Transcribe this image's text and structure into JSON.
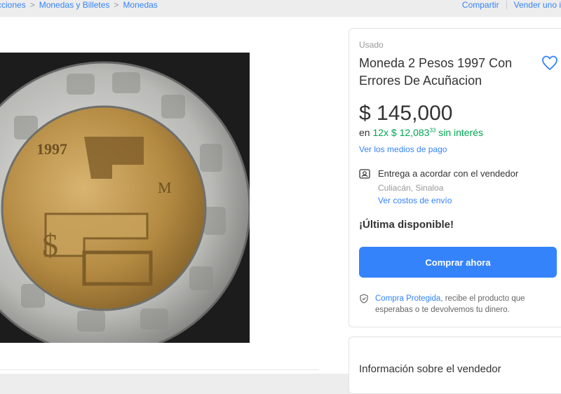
{
  "breadcrumb": {
    "items": [
      "cciones",
      "Monedas y Billetes",
      "Monedas"
    ],
    "separator": ">"
  },
  "actions": {
    "share": "Compartir",
    "sell": "Vender uno i"
  },
  "product": {
    "condition": "Usado",
    "title": "Moneda 2 Pesos 1997 Con Errores De Acuñacion",
    "price": "$ 145,000",
    "installments_prefix": "en",
    "installments_text": "12x $ 12,083",
    "installments_cents": "33",
    "installments_suffix": "sin interés",
    "payment_link": "Ver los medios de pago",
    "favorite_icon": "heart-icon"
  },
  "shipping": {
    "icon": "delivery-icon",
    "title": "Entrega a acordar con el vendedor",
    "location": "Culiacán, Sinaloa",
    "costs_link": "Ver costos de envío"
  },
  "stock": "¡Última disponible!",
  "buy_button": "Comprar ahora",
  "protection": {
    "icon": "shield-icon",
    "link": "Compra Protegida",
    "text": ", recibe el producto que esperabas o te devolvemos tu dinero."
  },
  "seller": {
    "title": "Información sobre el vendedor"
  },
  "image": {
    "coin_year": "1997"
  },
  "colors": {
    "accent": "#3483fa",
    "green": "#00a650",
    "background": "#ededed"
  }
}
